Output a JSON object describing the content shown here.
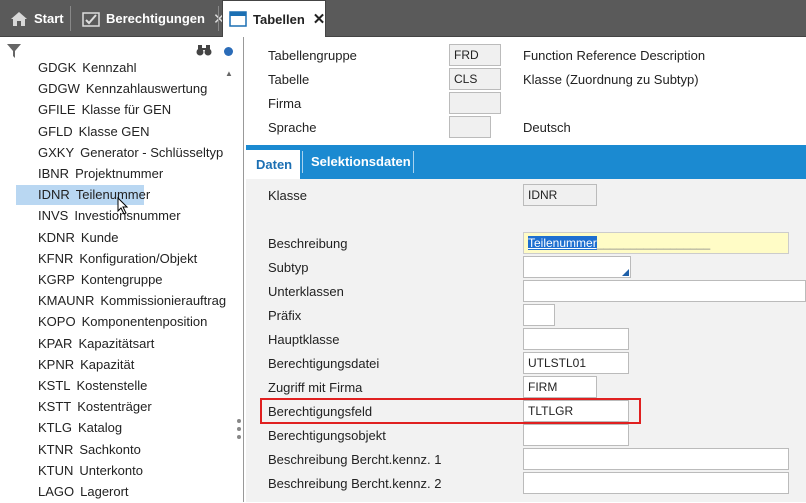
{
  "tabs": [
    {
      "label": "Start",
      "icon": "home-icon"
    },
    {
      "label": "Berechtigungen",
      "icon": "permissions-icon",
      "close": "✕"
    },
    {
      "label": "Tabellen",
      "icon": "window-icon",
      "close": "✕",
      "active": true
    }
  ],
  "list": [
    {
      "code": "GDGK",
      "label": "Kennzahl"
    },
    {
      "code": "GDGW",
      "label": "Kennzahlauswertung"
    },
    {
      "code": "GFILE",
      "label": "Klasse für GEN"
    },
    {
      "code": "GFLD",
      "label": "Klasse GEN"
    },
    {
      "code": "GXKY",
      "label": "Generator - Schlüsseltyp"
    },
    {
      "code": "IBNR",
      "label": "Projektnummer"
    },
    {
      "code": "IDNR",
      "label": "Teilenummer",
      "selected": true
    },
    {
      "code": "INVS",
      "label": "Investionsnummer"
    },
    {
      "code": "KDNR",
      "label": "Kunde"
    },
    {
      "code": "KFNR",
      "label": "Konfiguration/Objekt"
    },
    {
      "code": "KGRP",
      "label": "Kontengruppe"
    },
    {
      "code": "KMAUNR",
      "label": "Kommissionierauftrag"
    },
    {
      "code": "KOPO",
      "label": "Komponentenposition"
    },
    {
      "code": "KPAR",
      "label": "Kapazitätsart"
    },
    {
      "code": "KPNR",
      "label": "Kapazität"
    },
    {
      "code": "KSTL",
      "label": "Kostenstelle"
    },
    {
      "code": "KSTT",
      "label": "Kostenträger"
    },
    {
      "code": "KTLG",
      "label": "Katalog"
    },
    {
      "code": "KTNR",
      "label": "Sachkonto"
    },
    {
      "code": "KTUN",
      "label": "Unterkonto"
    },
    {
      "code": "LAGO",
      "label": "Lagerort"
    }
  ],
  "header": {
    "tabellengruppe_label": "Tabellengruppe",
    "tabellengruppe_value": "FRD",
    "tabellengruppe_desc": "Function Reference Description",
    "tabelle_label": "Tabelle",
    "tabelle_value": "CLS",
    "tabelle_desc": "Klasse (Zuordnung zu Subtyp)",
    "firma_label": "Firma",
    "firma_value": "",
    "sprache_label": "Sprache",
    "sprache_value": "",
    "sprache_desc": "Deutsch"
  },
  "subtabs": [
    "Daten",
    "Selektionsdaten"
  ],
  "form": {
    "klasse_label": "Klasse",
    "klasse_value": "IDNR",
    "beschreibung_label": "Beschreibung",
    "beschreibung_value": "Teilenummer",
    "beschreibung_trail": "_________________",
    "subtyp_label": "Subtyp",
    "subtyp_value": "",
    "unterklassen_label": "Unterklassen",
    "unterklassen_value": "",
    "praefix_label": "Präfix",
    "praefix_value": "",
    "hauptklasse_label": "Hauptklasse",
    "hauptklasse_value": "",
    "berechtigungsdatei_label": "Berechtigungsdatei",
    "berechtigungsdatei_value": "UTLSTL01",
    "zugriff_label": "Zugriff mit Firma",
    "zugriff_value": "FIRM",
    "berechtigungsfeld_label": "Berechtigungsfeld",
    "berechtigungsfeld_value": "TLTLGR",
    "berechtigungsobjekt_label": "Berechtigungsobjekt",
    "berechtigungsobjekt_value": "",
    "beschr1_label": "Beschreibung Bercht.kennz. 1",
    "beschr1_value": "",
    "beschr2_label": "Beschreibung Bercht.kennz. 2",
    "beschr2_value": ""
  },
  "colors": {
    "tabbar": "#5a5a5a",
    "subtab_bar": "#1b8ad1",
    "selected_row": "#b9d7f2",
    "highlight_border": "#e02020",
    "selection": "#1e6fd0"
  }
}
